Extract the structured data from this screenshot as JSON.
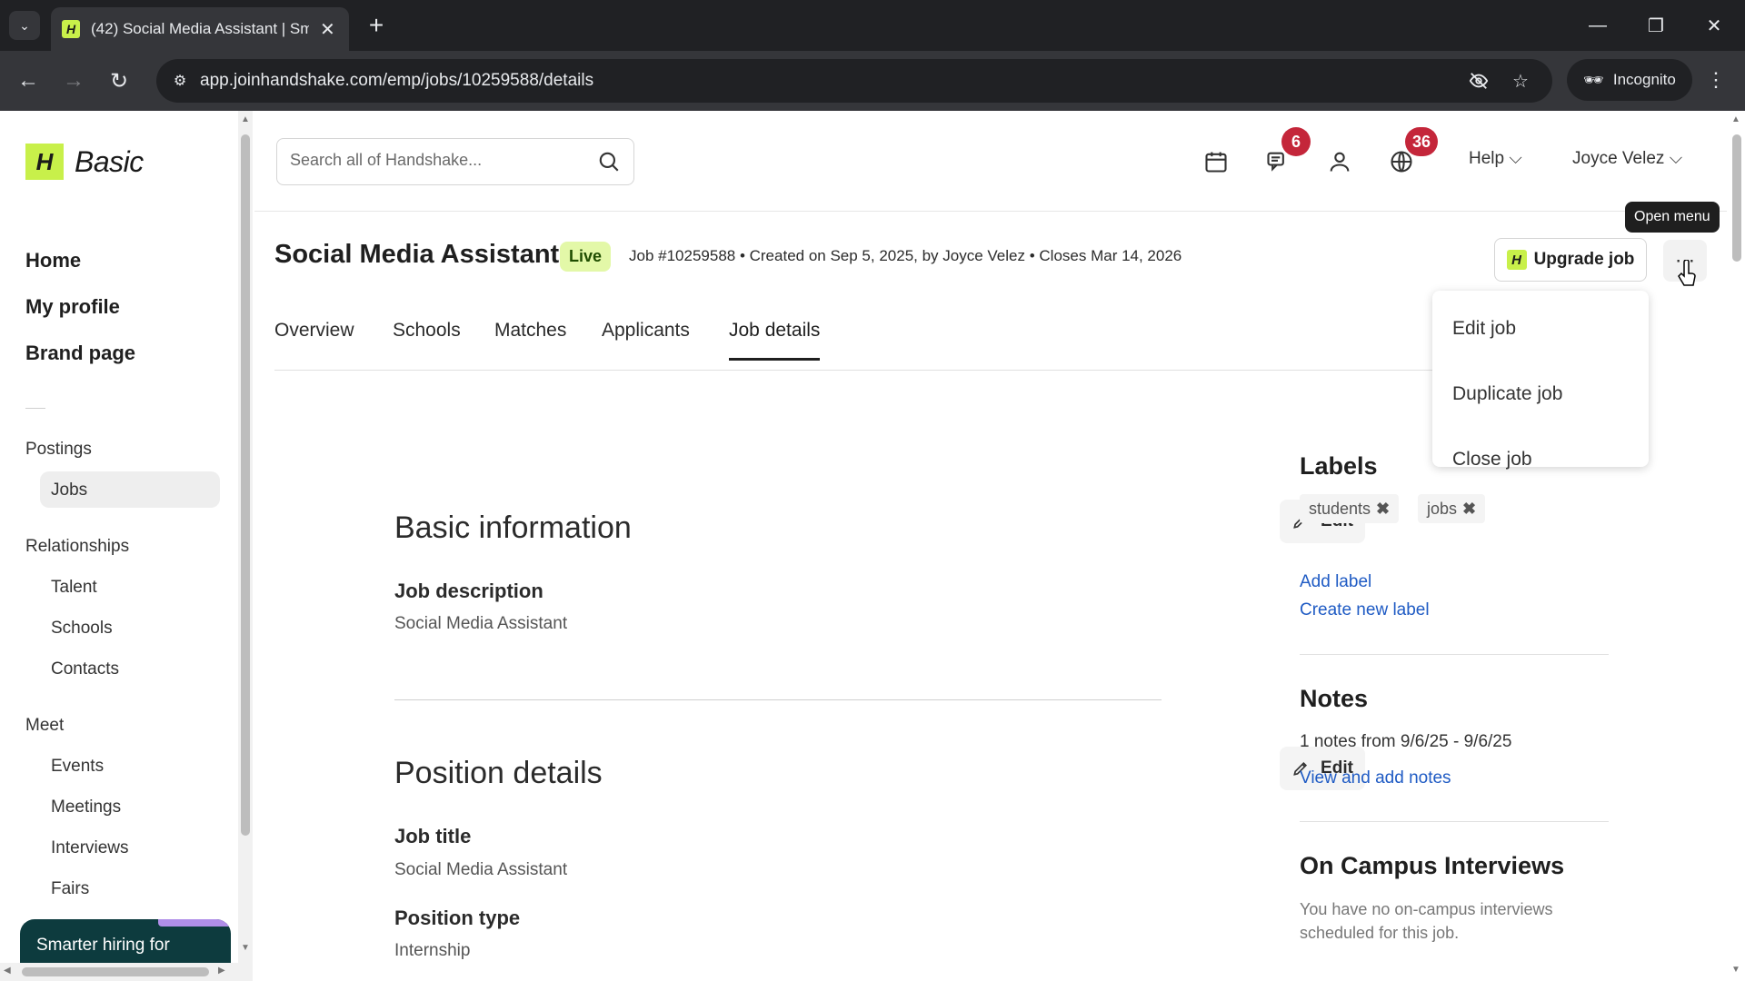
{
  "browser": {
    "tab_title": "(42) Social Media Assistant | Sm",
    "favicon_letter": "H",
    "url": "app.joinhandshake.com/emp/jobs/10259588/details",
    "incognito_label": "Incognito"
  },
  "brand": {
    "logo_letter": "H",
    "plan": "Basic"
  },
  "sidebar": {
    "primary": [
      {
        "label": "Home"
      },
      {
        "label": "My profile"
      },
      {
        "label": "Brand page"
      }
    ],
    "postings": {
      "title": "Postings",
      "items": [
        {
          "label": "Jobs",
          "active": true
        }
      ]
    },
    "relationships": {
      "title": "Relationships",
      "items": [
        {
          "label": "Talent"
        },
        {
          "label": "Schools"
        },
        {
          "label": "Contacts"
        }
      ]
    },
    "meet": {
      "title": "Meet",
      "items": [
        {
          "label": "Events"
        },
        {
          "label": "Meetings"
        },
        {
          "label": "Interviews"
        },
        {
          "label": "Fairs"
        }
      ]
    },
    "promo": "Smarter hiring for"
  },
  "header": {
    "search_placeholder": "Search all of Handshake...",
    "messages_count": "6",
    "notifications_count": "36",
    "help_label": "Help",
    "user_name": "Joyce Velez"
  },
  "job": {
    "title": "Social Media Assistant",
    "status": "Live",
    "meta": "Job #10259588 • Created on Sep 5, 2025, by Joyce Velez • Closes Mar 14, 2026",
    "upgrade_label": "Upgrade job",
    "more_tooltip": "Open menu"
  },
  "tabs": [
    "Overview",
    "Schools",
    "Matches",
    "Applicants",
    "Job details"
  ],
  "active_tab": "Job details",
  "menu": {
    "items": [
      "Edit job",
      "Duplicate job",
      "Close job"
    ]
  },
  "sections": {
    "basic": {
      "title": "Basic information",
      "edit_label": "Edit",
      "fields": [
        {
          "label": "Job description",
          "value": "Social Media Assistant"
        }
      ]
    },
    "position": {
      "title": "Position details",
      "edit_label": "Edit",
      "fields": [
        {
          "label": "Job title",
          "value": "Social Media Assistant"
        },
        {
          "label": "Position type",
          "value": "Internship"
        }
      ]
    }
  },
  "right_panel": {
    "labels": {
      "title": "Labels",
      "chips": [
        "students",
        "jobs"
      ],
      "add_label": "Add label",
      "create_label": "Create new label"
    },
    "notes": {
      "title": "Notes",
      "summary": "1 notes from 9/6/25 - 9/6/25",
      "link": "View and add notes"
    },
    "interviews": {
      "title": "On Campus Interviews",
      "text": "You have no on-campus interviews scheduled for this job."
    }
  },
  "colors": {
    "brand_green": "#c8f04a",
    "badge_red": "#c4263a",
    "link_blue": "#1f5bc4",
    "live_bg": "#e3f8a8",
    "promo_bg": "#0d3b3e"
  }
}
